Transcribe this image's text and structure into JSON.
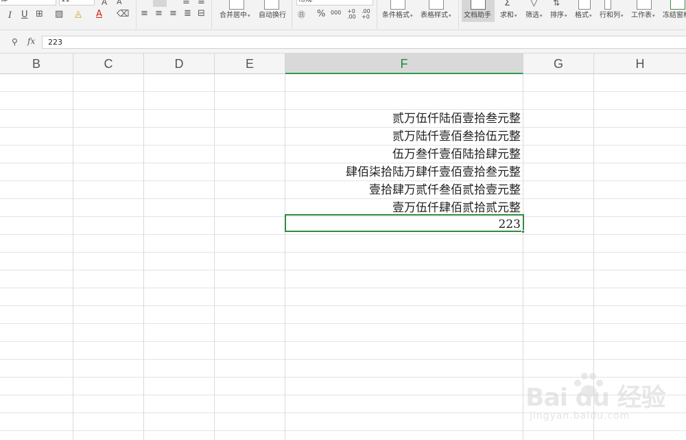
{
  "ribbon": {
    "font_name": "体",
    "font_size": "11",
    "number_format": "常规",
    "percent_symbol": "%",
    "thousands_symbol": "000",
    "inc_decimal_symbol": "+0 .00",
    "dec_decimal_symbol": ".00 +0",
    "merge_center_label": "合并居中",
    "wrap_text_label": "自动换行",
    "cond_format_label": "条件格式",
    "table_style_label": "表格样式",
    "doc_assistant_label": "文档助手",
    "sum_label": "求和",
    "filter_label": "筛选",
    "sort_label": "排序",
    "format_label": "格式",
    "rowcol_label": "行和列",
    "worksheet_label": "工作表",
    "freeze_label": "冻结窗格"
  },
  "formula_bar": {
    "fx": "fx",
    "value": "223"
  },
  "columns": [
    "B",
    "C",
    "D",
    "E",
    "F",
    "G",
    "H"
  ],
  "selected_column": "F",
  "cells_f": [
    "贰万伍仟陆佰壹拾叁元整",
    "贰万陆仟壹佰叁拾伍元整",
    "伍万叁仟壹佰陆拾肆元整",
    "肆佰柒拾陆万肆仟壹佰壹拾叁元整",
    "壹拾肆万贰仟叁佰贰拾壹元整",
    "壹万伍仟肆佰贰拾贰元整",
    "223"
  ],
  "watermark": {
    "logo": "Bai du 经验",
    "url": "jingyan.baidu.com"
  },
  "colors": {
    "accent_green": "#2e8b3f",
    "header_selected_text": "#1f8a3c"
  }
}
